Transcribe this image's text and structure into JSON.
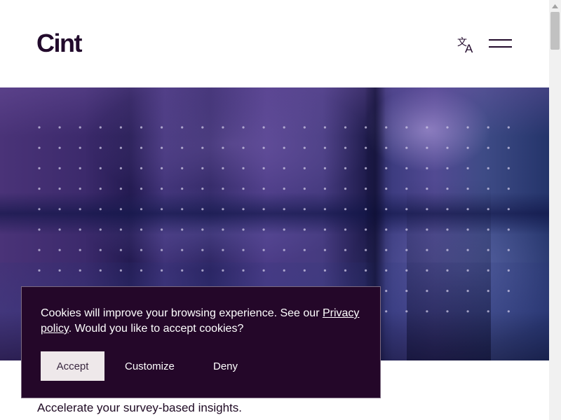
{
  "header": {
    "logo_text": "Cint",
    "language_icon": "translate-icon",
    "menu_icon": "hamburger-menu-icon"
  },
  "hero": {
    "background": "blurred-office-photo"
  },
  "cookie_banner": {
    "text_before_link": "Cookies will improve your browsing experience. See our ",
    "link_text": "Privacy policy",
    "text_after_link": ". Would you like to accept cookies?",
    "accept_label": "Accept",
    "customize_label": "Customize",
    "deny_label": "Deny"
  },
  "main": {
    "tagline": "Accelerate your survey-based insights."
  },
  "colors": {
    "brand_dark": "#220a2c",
    "banner_bg": "#240729",
    "accept_bg": "#eee8ea",
    "hero_base": "#3c2a6c"
  }
}
